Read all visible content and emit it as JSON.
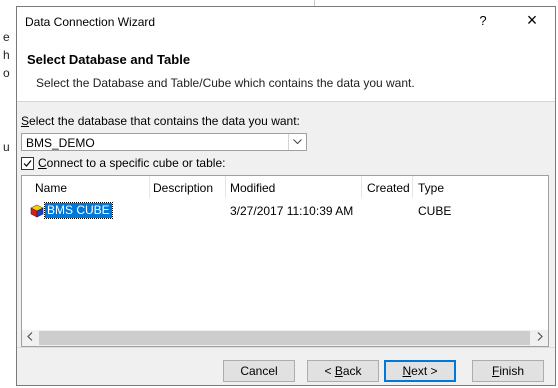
{
  "background": {
    "fragments": [
      "e",
      "h",
      "o",
      "u"
    ]
  },
  "dialog": {
    "title": "Data Connection Wizard",
    "help": "?",
    "close": "×",
    "header_title": "Select Database and Table",
    "header_subtitle": "Select the Database and Table/Cube which contains the data you want."
  },
  "database": {
    "label_prefix": "S",
    "label_rest": "elect the database that contains the data you want:",
    "selected": "BMS_DEMO"
  },
  "cube_checkbox": {
    "checked": true,
    "label_prefix": "C",
    "label_rest": "onnect to a specific cube or table:"
  },
  "table": {
    "columns": [
      "Name",
      "Description",
      "Modified",
      "Created",
      "Type"
    ],
    "rows": [
      {
        "name": "BMS CUBE",
        "description": "",
        "modified": "3/27/2017 11:10:39 AM",
        "created": "",
        "type": "CUBE",
        "selected": true
      }
    ]
  },
  "buttons": {
    "cancel": "Cancel",
    "back_prefix": "< ",
    "back_u": "B",
    "back_rest": "ack",
    "next_u": "N",
    "next_rest": "ext >",
    "finish_u": "F",
    "finish_rest": "inish"
  },
  "colors": {
    "accent": "#0078d7",
    "dialog_bg": "#f0f0f0"
  }
}
